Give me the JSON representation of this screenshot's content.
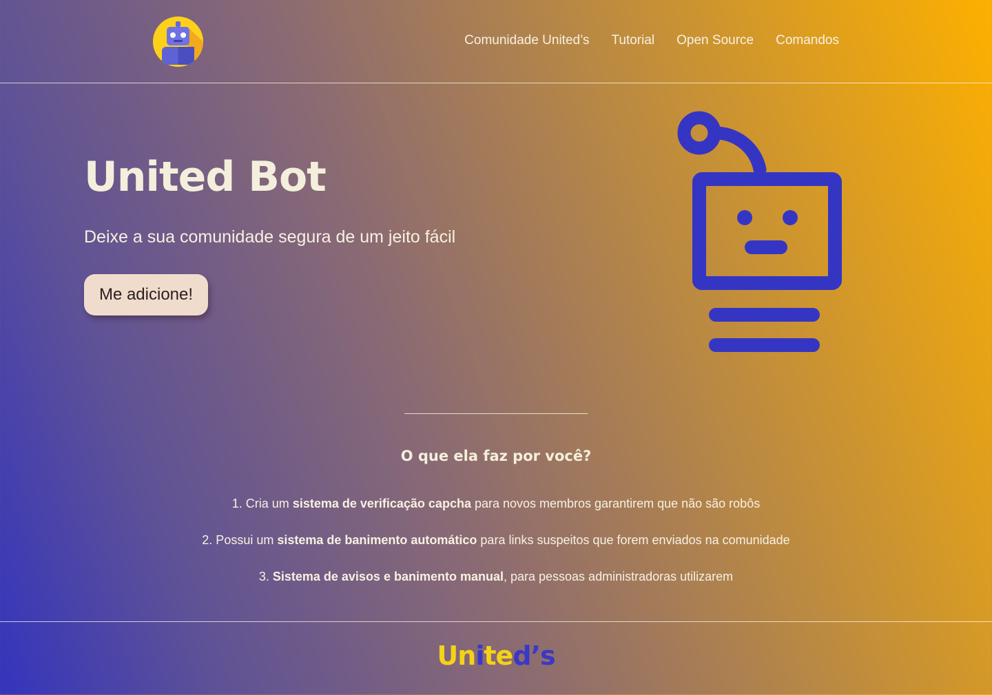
{
  "nav": {
    "items": [
      {
        "label": "Comunidade United’s"
      },
      {
        "label": "Tutorial"
      },
      {
        "label": "Open Source"
      },
      {
        "label": "Comandos"
      }
    ]
  },
  "hero": {
    "title": "United Bot",
    "subtitle": "Deixe a sua comunidade segura de um jeito fácil",
    "button_label": "Me adicione!"
  },
  "features": {
    "title": "O que ela faz por você?",
    "items": [
      {
        "prefix": "1. Cria um ",
        "bold": "sistema de verificação capcha",
        "suffix": " para novos membros garantirem que não são robôs"
      },
      {
        "prefix": "2. Possui um ",
        "bold": "sistema de banimento automático",
        "suffix": " para links suspeitos que forem enviados na comunidade"
      },
      {
        "prefix": "3. ",
        "bold": "Sistema de avisos e banimento manual",
        "suffix": ", para pessoas administradoras utilizarem"
      }
    ]
  },
  "footer": {
    "brand_letters": [
      {
        "ch": "U",
        "color": "#f3d21a"
      },
      {
        "ch": "n",
        "color": "#f3d21a"
      },
      {
        "ch": "i",
        "color": "#3a38c4"
      },
      {
        "ch": "t",
        "color": "#f3d21a"
      },
      {
        "ch": "e",
        "color": "#f3d21a"
      },
      {
        "ch": "d",
        "color": "#3a38c4"
      },
      {
        "ch": "’",
        "color": "#3a38c4"
      },
      {
        "ch": "s",
        "color": "#3a38c4"
      }
    ]
  },
  "icons": {
    "logo": "robot-avatar-icon",
    "hero_illustration": "robot-line-icon"
  },
  "colors": {
    "gradient_start": "#3434bd",
    "gradient_end": "#fdb000",
    "robot_blue": "#3535c4",
    "button_bg": "#f0dccd",
    "text_cream": "#f4efdc"
  }
}
